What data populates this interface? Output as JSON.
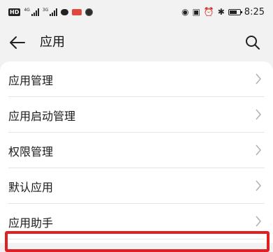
{
  "status_bar": {
    "hd_badge": "HD",
    "signal1_gen": "4G",
    "signal2_gen": "3G",
    "time": "8:25"
  },
  "header": {
    "title": "应用"
  },
  "settings_list": {
    "items": [
      {
        "label": "应用管理"
      },
      {
        "label": "应用启动管理"
      },
      {
        "label": "权限管理"
      },
      {
        "label": "默认应用"
      },
      {
        "label": "应用助手"
      }
    ]
  },
  "colors": {
    "background": "#f2f2f2",
    "card": "#ffffff",
    "highlight_border": "#e02020"
  }
}
